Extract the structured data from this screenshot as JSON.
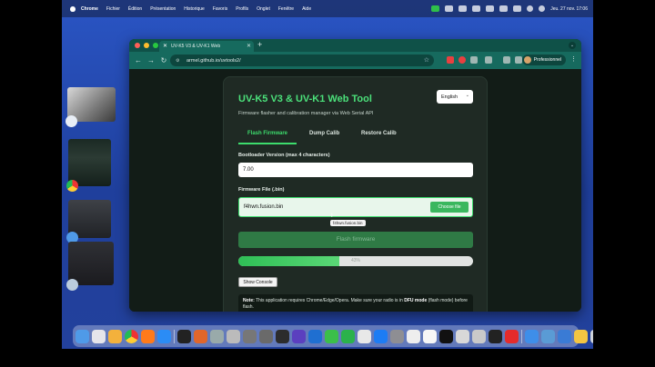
{
  "menubar": {
    "app": "Chrome",
    "items": [
      "Fichier",
      "Édition",
      "Présentation",
      "Historique",
      "Favoris",
      "Profils",
      "Onglet",
      "Fenêtre",
      "Aide"
    ],
    "clock": "Jeu. 27 nov. 17:06"
  },
  "browser": {
    "tab_title": "UV-K5 V3 & UV-K1 Web",
    "url": "armel.github.io/uvtools2/",
    "profile_label": "Professionnel"
  },
  "page": {
    "title": "UV-K5 V3 & UV-K1 Web Tool",
    "subtitle": "Firmware flasher and calibration manager via Web Serial API",
    "language": "English",
    "tabs": {
      "flash": "Flash Firmware",
      "dump": "Dump Calib",
      "restore": "Restore Calib"
    },
    "bootloader_label": "Bootloader Version (max 4 characters)",
    "bootloader_value": "7.00",
    "firmware_label": "Firmware File (.bin)",
    "file_name": "f4hwn.fusion.bin",
    "choose_label": "Choose file",
    "tooltip": "f4hwn.fusion.bin",
    "flash_button": "Flash firmware",
    "progress": {
      "value": 43,
      "label": "43%"
    },
    "console_button": "Show Console",
    "note_bold": "Note:",
    "note_text": " This application requires Chrome/Edge/Opera. Make sure your radio is in ",
    "note_dfu": "DFU mode",
    "note_tail": " (flash mode) before flash."
  },
  "colors": {
    "accent": "#3ddc6d",
    "chrome_frame": "#166a5e",
    "page_bg": "#121c17"
  },
  "icons": {
    "tab_favicon": "tools-icon",
    "new_tab": "plus-icon",
    "back": "arrow-left-icon",
    "forward": "arrow-right-icon",
    "reload": "reload-icon",
    "bookmark": "star-icon",
    "menu": "kebab-icon"
  }
}
